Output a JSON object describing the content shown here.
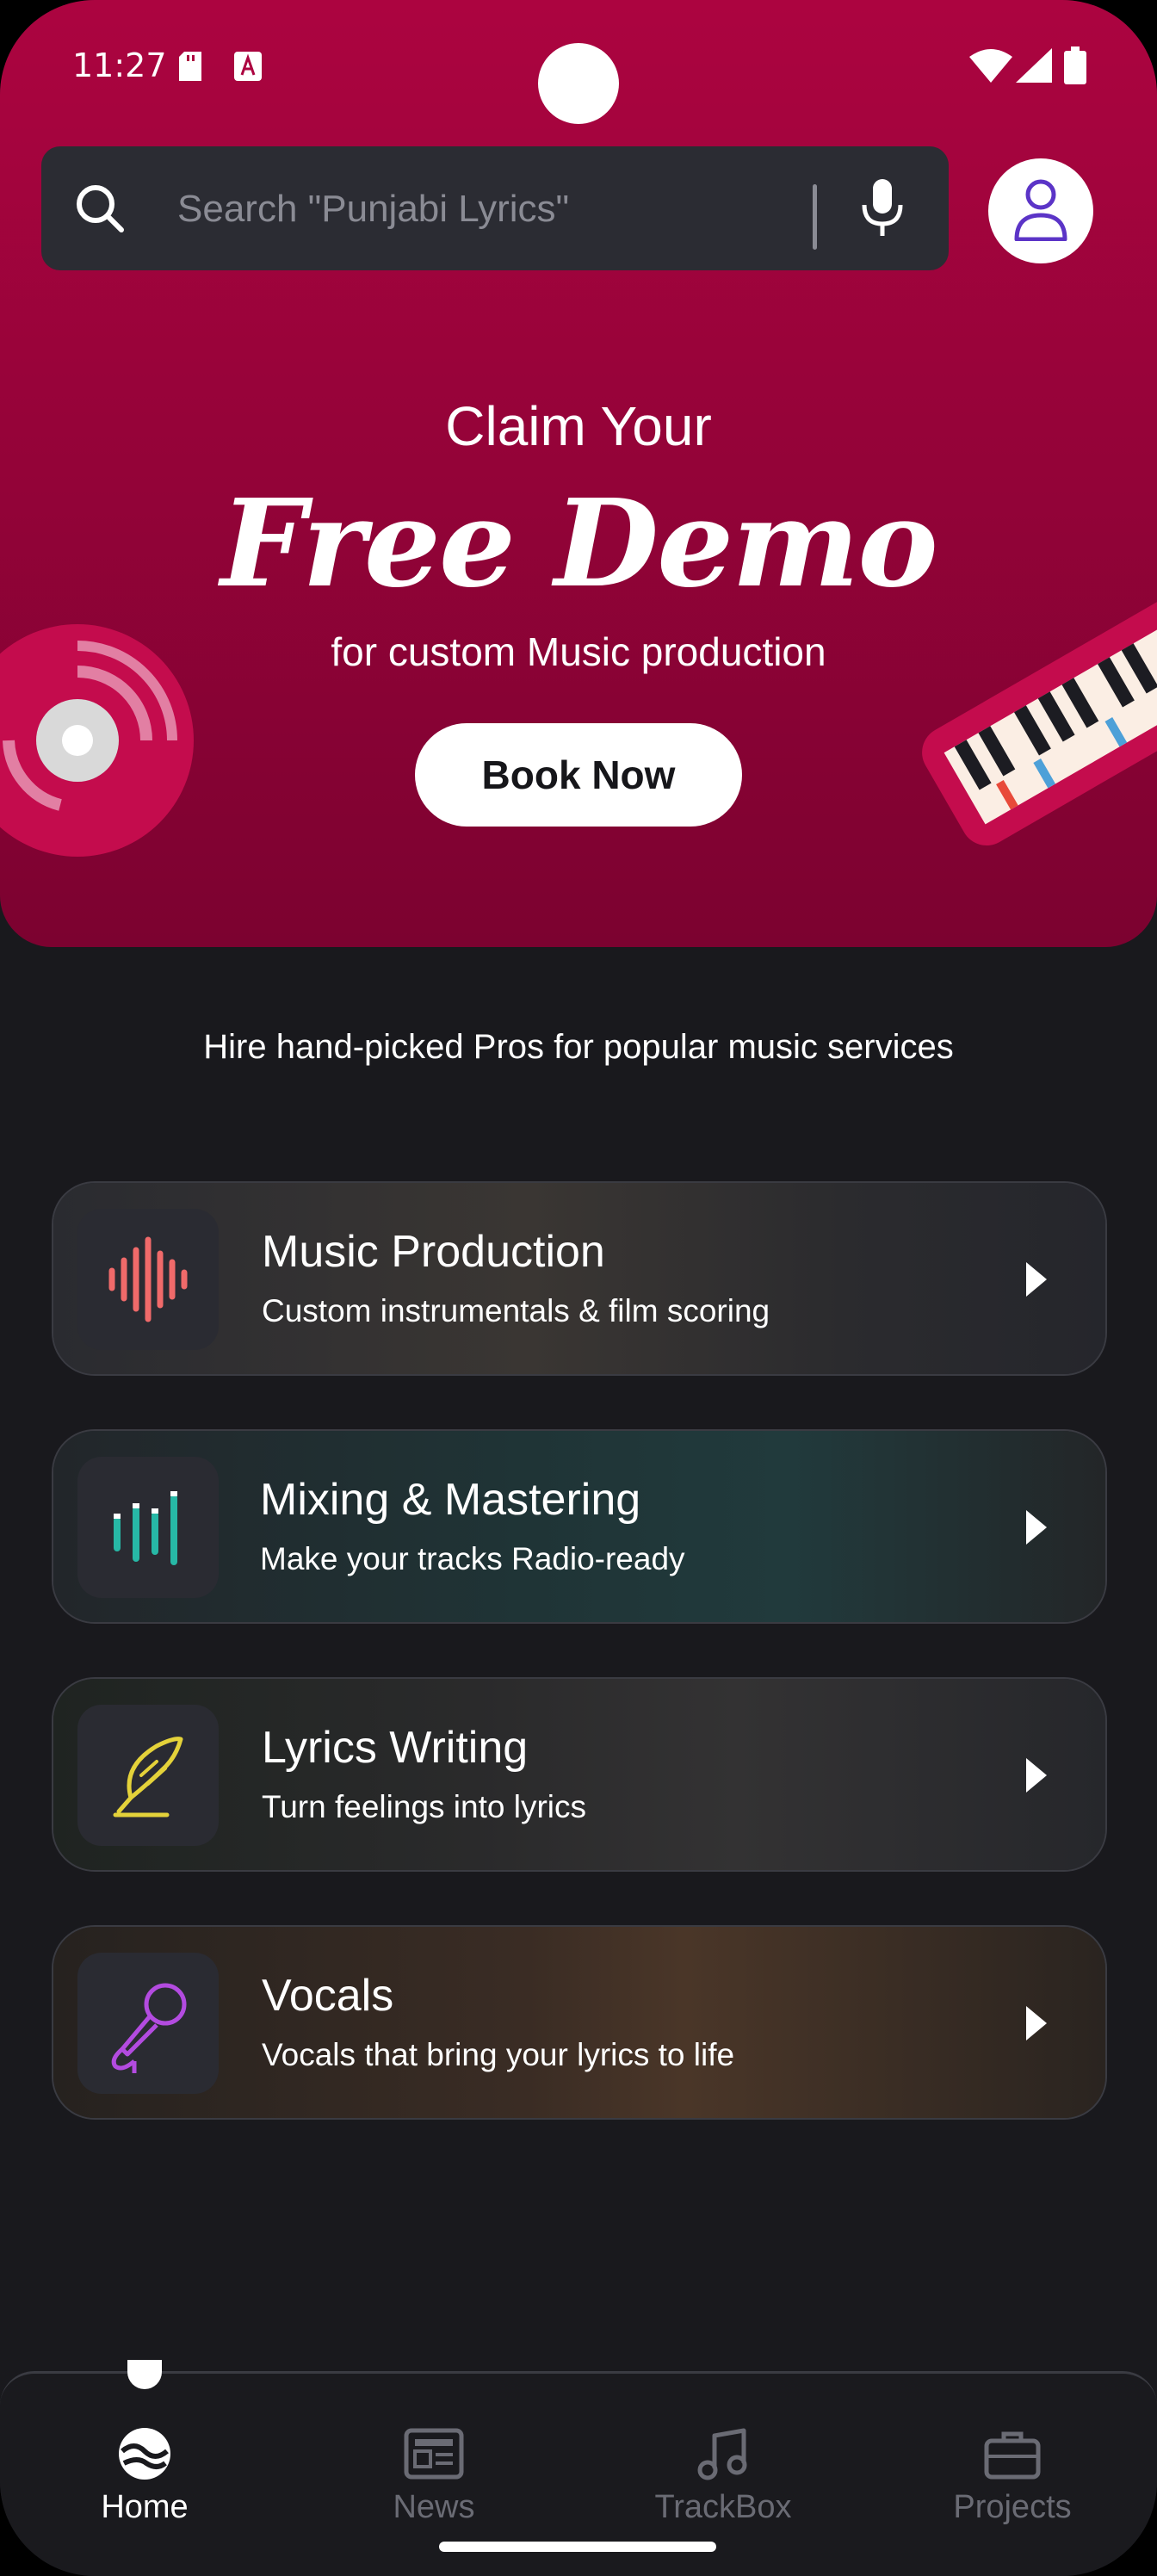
{
  "status_bar": {
    "time": "11:27"
  },
  "search": {
    "placeholder": "Search \"Punjabi Lyrics\""
  },
  "promo": {
    "line1": "Claim Your",
    "title": "Free Demo",
    "line2": "for custom Music production",
    "button_label": "Book Now"
  },
  "section_caption": "Hire  hand-picked Pros for popular music services",
  "services": [
    {
      "title": "Music Production",
      "subtitle": "Custom instrumentals & film scoring",
      "icon": "waveform-icon",
      "accent": "#f06a6a"
    },
    {
      "title": "Mixing & Mastering",
      "subtitle": "Make your tracks Radio-ready",
      "icon": "equalizer-icon",
      "accent": "#27b8a6"
    },
    {
      "title": "Lyrics Writing",
      "subtitle": "Turn feelings into lyrics",
      "icon": "quill-icon",
      "accent": "#e4d23a"
    },
    {
      "title": "Vocals",
      "subtitle": "Vocals that bring your lyrics to life",
      "icon": "microphone-icon",
      "accent": "#b34be0"
    }
  ],
  "nav": {
    "items": [
      {
        "label": "Home",
        "icon": "home-icon",
        "active": true
      },
      {
        "label": "News",
        "icon": "news-icon",
        "active": false
      },
      {
        "label": "TrackBox",
        "icon": "music-note-icon",
        "active": false
      },
      {
        "label": "Projects",
        "icon": "briefcase-icon",
        "active": false
      }
    ]
  },
  "colors": {
    "brand": "#ac0440",
    "background": "#19191d",
    "card_border": "#3a3b42",
    "inactive_nav": "#6a6b74"
  }
}
